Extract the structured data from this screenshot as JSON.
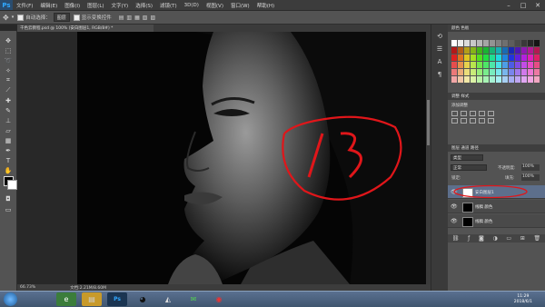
{
  "app": {
    "logo": "Ps"
  },
  "menu": [
    "文件(F)",
    "编辑(E)",
    "图像(I)",
    "图层(L)",
    "文字(Y)",
    "选择(S)",
    "滤镜(T)",
    "3D(D)",
    "视图(V)",
    "窗口(W)",
    "帮助(H)"
  ],
  "window_controls": {
    "minimize": "–",
    "maximize": "□",
    "close": "✕"
  },
  "options": {
    "auto_select_label": "自动选择：",
    "auto_select_value": "图层",
    "show_transform_label": "显示变换控件"
  },
  "document": {
    "tab_title": "千色云教程.psd @ 100% (安白图层1, RGB/8#) *",
    "zoom": "66.73%",
    "doc_info": "文档:2.21M/8.60M"
  },
  "panels": {
    "swatches_tab": "颜色  色板",
    "adjustments_tab": "调整  样式",
    "adjust_hint": "添加调整",
    "layers_tabs": "图层  通道  路径",
    "kind_label": "类型",
    "blend_mode": "正常",
    "opacity_label": "不透明度:",
    "opacity_value": "100%",
    "lock_label": "锁定:",
    "fill_label": "填充:",
    "fill_value": "100%"
  },
  "layers": [
    {
      "name": "安白图层1",
      "selected": true,
      "thumb": "#ffffff"
    },
    {
      "name": "线稿 颜色",
      "selected": false,
      "thumb": "#000000"
    },
    {
      "name": "线稿 颜色",
      "selected": false,
      "thumb": "#000000"
    }
  ],
  "annotation": {
    "text": "13",
    "color": "#e0161a"
  },
  "taskbar": {
    "time": "11:29",
    "date": "2018/6/1"
  },
  "colors": {
    "accent": "#31a8ff",
    "selected_layer": "#5d6f8c"
  }
}
